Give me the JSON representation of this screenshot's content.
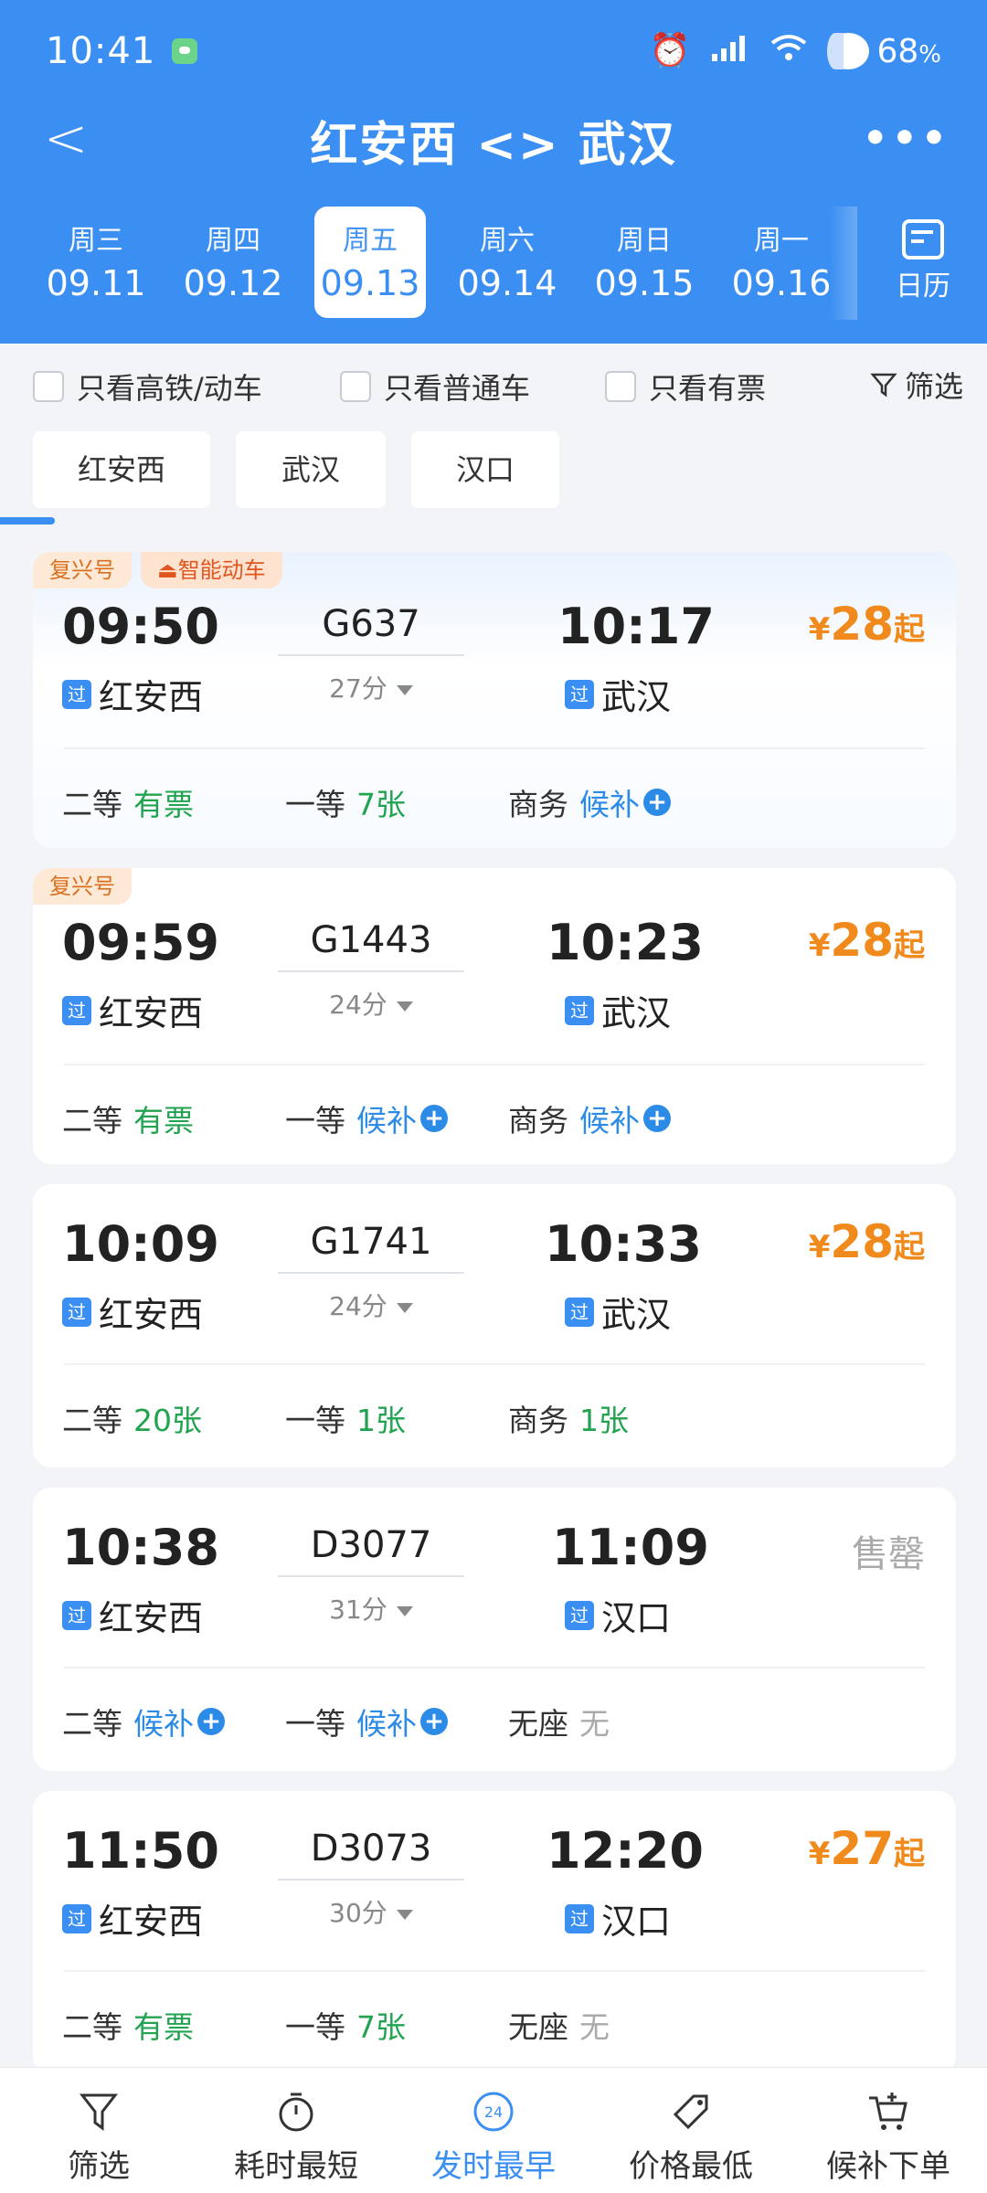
{
  "status_bar": {
    "time": "10:41",
    "battery": "68",
    "battery_unit": "%"
  },
  "header": {
    "title": "红安西 <> 武汉"
  },
  "dates": [
    {
      "weekday": "周三",
      "date": "09.11",
      "active": false
    },
    {
      "weekday": "周四",
      "date": "09.12",
      "active": false
    },
    {
      "weekday": "周五",
      "date": "09.13",
      "active": true
    },
    {
      "weekday": "周六",
      "date": "09.14",
      "active": false
    },
    {
      "weekday": "周日",
      "date": "09.15",
      "active": false
    },
    {
      "weekday": "周一",
      "date": "09.16",
      "active": false
    }
  ],
  "calendar_label": "日历",
  "filters": {
    "high_speed": "只看高铁/动车",
    "normal": "只看普通车",
    "available": "只看有票",
    "filter_label": "筛选"
  },
  "station_chips": [
    "红安西",
    "武汉",
    "汉口"
  ],
  "trains": [
    {
      "tags": [
        "复兴号",
        "智能动车"
      ],
      "dep_time": "09:50",
      "dep_station": "红安西",
      "train_no": "G637",
      "duration": "27分",
      "arr_time": "10:17",
      "arr_station": "武汉",
      "price_symbol": "¥",
      "price": "28",
      "price_suffix": "起",
      "seats": [
        {
          "class": "二等",
          "value": "有票",
          "color": "green",
          "plus": false
        },
        {
          "class": "一等",
          "value": "7张",
          "color": "green",
          "plus": false
        },
        {
          "class": "商务",
          "value": "候补",
          "color": "blue",
          "plus": true
        }
      ]
    },
    {
      "tags": [
        "复兴号"
      ],
      "dep_time": "09:59",
      "dep_station": "红安西",
      "train_no": "G1443",
      "duration": "24分",
      "arr_time": "10:23",
      "arr_station": "武汉",
      "price_symbol": "¥",
      "price": "28",
      "price_suffix": "起",
      "seats": [
        {
          "class": "二等",
          "value": "有票",
          "color": "green",
          "plus": false
        },
        {
          "class": "一等",
          "value": "候补",
          "color": "blue",
          "plus": true
        },
        {
          "class": "商务",
          "value": "候补",
          "color": "blue",
          "plus": true
        }
      ]
    },
    {
      "tags": [],
      "dep_time": "10:09",
      "dep_station": "红安西",
      "train_no": "G1741",
      "duration": "24分",
      "arr_time": "10:33",
      "arr_station": "武汉",
      "price_symbol": "¥",
      "price": "28",
      "price_suffix": "起",
      "seats": [
        {
          "class": "二等",
          "value": "20张",
          "color": "green",
          "plus": false
        },
        {
          "class": "一等",
          "value": "1张",
          "color": "green",
          "plus": false
        },
        {
          "class": "商务",
          "value": "1张",
          "color": "green",
          "plus": false
        }
      ]
    },
    {
      "tags": [],
      "dep_time": "10:38",
      "dep_station": "红安西",
      "train_no": "D3077",
      "duration": "31分",
      "arr_time": "11:09",
      "arr_station": "汉口",
      "sold_out": "售罄",
      "seats": [
        {
          "class": "二等",
          "value": "候补",
          "color": "blue",
          "plus": true
        },
        {
          "class": "一等",
          "value": "候补",
          "color": "blue",
          "plus": true
        },
        {
          "class": "无座",
          "value": "无",
          "color": "gray",
          "plus": false
        }
      ]
    },
    {
      "tags": [],
      "dep_time": "11:50",
      "dep_station": "红安西",
      "train_no": "D3073",
      "duration": "30分",
      "arr_time": "12:20",
      "arr_station": "汉口",
      "price_symbol": "¥",
      "price": "27",
      "price_suffix": "起",
      "seats": [
        {
          "class": "二等",
          "value": "有票",
          "color": "green",
          "plus": false
        },
        {
          "class": "一等",
          "value": "7张",
          "color": "green",
          "plus": false
        },
        {
          "class": "无座",
          "value": "无",
          "color": "gray",
          "plus": false
        }
      ]
    }
  ],
  "pass_badge": "过",
  "bottom_tabs": [
    {
      "label": "筛选",
      "icon": "filter-icon",
      "active": false
    },
    {
      "label": "耗时最短",
      "icon": "stopwatch-icon",
      "active": false
    },
    {
      "label": "发时最早",
      "icon": "clock-24-icon",
      "active": true
    },
    {
      "label": "价格最低",
      "icon": "price-tag-icon",
      "active": false
    },
    {
      "label": "候补下单",
      "icon": "cart-add-icon",
      "active": false
    }
  ],
  "colors": {
    "primary": "#3b8ff2",
    "price": "#f08a1c",
    "available": "#21a350",
    "waitlist": "#2d8be8"
  }
}
